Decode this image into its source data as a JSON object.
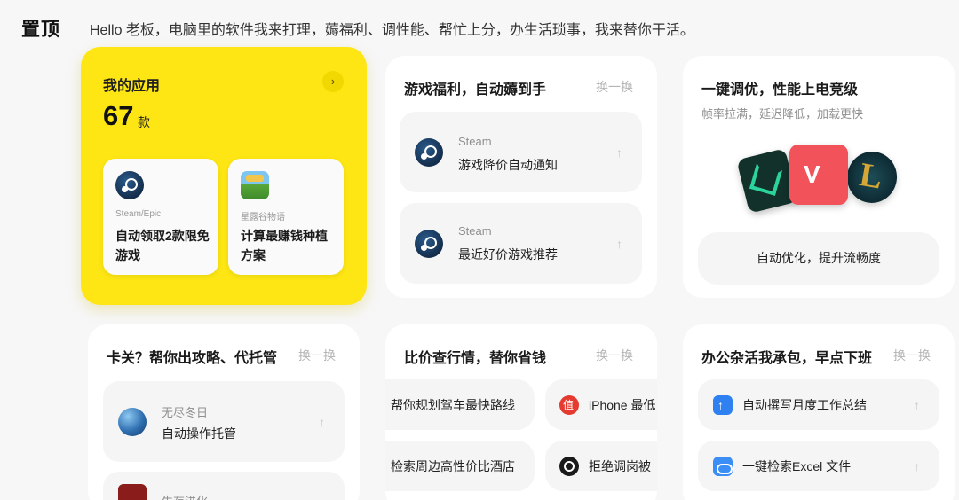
{
  "header": {
    "title": "置顶",
    "slogan": "Hello 老板，电脑里的软件我来打理，薅福利、调性能、帮忙上分，办生活琐事，我来替你干活。"
  },
  "my_apps": {
    "title": "我的应用",
    "more_icon": "chevron-right-icon",
    "count": "67",
    "unit": "款",
    "items": [
      {
        "source": "Steam/Epic",
        "label": "自动领取2款限免游戏",
        "icon": "steam-icon"
      },
      {
        "source": "星露谷物语",
        "label": "计算最赚钱种植方案",
        "icon": "stardew-valley-icon"
      }
    ]
  },
  "game_deals": {
    "title": "游戏福利，自动薅到手",
    "swap": "换一换",
    "rows": [
      {
        "source": "Steam",
        "label": "游戏降价自动通知",
        "icon": "steam-icon"
      },
      {
        "source": "Steam",
        "label": "最近好价游戏推荐",
        "icon": "steam-icon"
      }
    ]
  },
  "tuning": {
    "title": "一键调优，性能上电竞级",
    "subtitle": "帧率拉满，延迟降低，加载更快",
    "action": "自动优化，提升流畅度",
    "icons": [
      "game-a-icon",
      "valorant-icon",
      "league-of-legends-icon"
    ]
  },
  "stuck": {
    "title": "卡关？帮你出攻略、代托管",
    "swap": "换一换",
    "rows": [
      {
        "source": "无尽冬日",
        "label": "自动操作托管",
        "icon": "whiteout-survival-icon"
      },
      {
        "source": "生存进化",
        "label": "",
        "icon": "game-icon"
      }
    ]
  },
  "price_compare": {
    "title": "比价查行情，替你省钱",
    "swap": "换一换",
    "pills": [
      {
        "label": "帮你规划驾车最快路线",
        "icon": ""
      },
      {
        "label": "iPhone 最低",
        "icon": "smzdm-icon"
      },
      {
        "label": "检索周边高性价比酒店",
        "icon": ""
      },
      {
        "label": "拒绝调岗被",
        "icon": "search-app-icon"
      }
    ]
  },
  "office": {
    "title": "办公杂活我承包，早点下班",
    "swap": "换一换",
    "rows": [
      {
        "label": "自动撰写月度工作总结",
        "icon": "upload-app-icon"
      },
      {
        "label": "一键检索Excel 文件",
        "icon": "cloud-drive-icon"
      }
    ]
  },
  "colors": {
    "accent_yellow": "#fde613",
    "background": "#f7f7f8",
    "card": "#ffffff",
    "row": "#f5f5f6"
  }
}
